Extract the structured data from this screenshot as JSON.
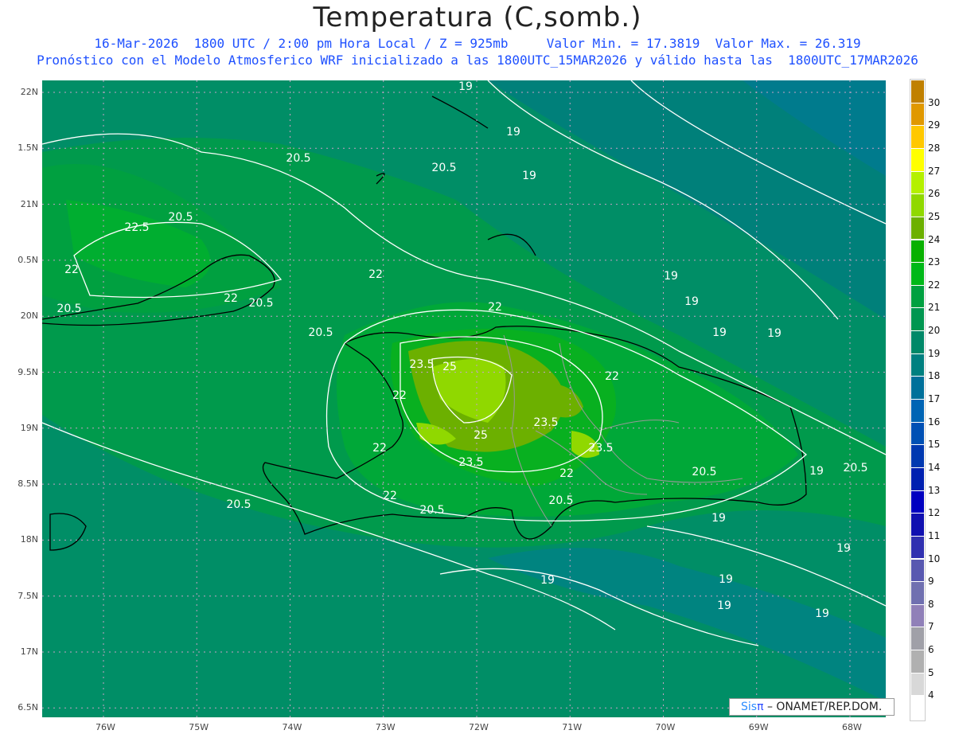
{
  "title": "Temperatura (C,somb.)",
  "subtitle_line1": "16-Mar-2026  1800 UTC / 2:00 pm Hora Local / Z = 925mb     Valor Min. = 17.3819  Valor Max. = 26.319",
  "subtitle_line2": "Pronóstico con el Modelo Atmosferico WRF inicializado a las 1800UTC_15MAR2026 y válido hasta las  1800UTC_17MAR2026",
  "lon_labels": [
    "76W",
    "75W",
    "74W",
    "73W",
    "72W",
    "71W",
    "70W",
    "69W",
    "68W"
  ],
  "lat_labels": [
    "22N",
    "1.5N",
    "21N",
    "0.5N",
    "20N",
    "9.5N",
    "19N",
    "8.5N",
    "18N",
    "7.5N",
    "17N",
    "6.5N"
  ],
  "colorbar": {
    "labels": [
      "30",
      "29",
      "28",
      "27",
      "26",
      "25",
      "24",
      "23",
      "22",
      "21",
      "20",
      "19",
      "18",
      "17",
      "16",
      "15",
      "14",
      "13",
      "12",
      "11",
      "10",
      "9",
      "8",
      "7",
      "6",
      "5",
      "4"
    ],
    "colors": [
      "#c08000",
      "#e09800",
      "#ffc800",
      "#ffff00",
      "#b4f000",
      "#90d800",
      "#6cb000",
      "#08b000",
      "#00b818",
      "#00a040",
      "#009650",
      "#008868",
      "#008080",
      "#00709a",
      "#0064b4",
      "#0050b4",
      "#0038b0",
      "#0020b0",
      "#0000c0",
      "#1010b0",
      "#3030b0",
      "#5858b0",
      "#7070b0",
      "#9080b8",
      "#a0a0a8",
      "#b0b0b0",
      "#d8d8d8",
      "#ffffff"
    ]
  },
  "contour_labels": [
    "19",
    "19",
    "19",
    "20.5",
    "20.5",
    "19",
    "20.5",
    "22.5",
    "22",
    "22",
    "20.5",
    "22",
    "20.5",
    "22",
    "19",
    "19",
    "19",
    "20.5",
    "23.5",
    "25",
    "22",
    "22",
    "23.5",
    "25",
    "23.5",
    "22",
    "23.5",
    "22",
    "20.5",
    "20.5",
    "22",
    "20.5",
    "20.5",
    "19",
    "20.5",
    "19",
    "19",
    "19",
    "19",
    "19",
    "19"
  ],
  "logo": {
    "sis": "Sis",
    "pi": "π",
    "text": " –  ONAMET/REP.DOM."
  }
}
